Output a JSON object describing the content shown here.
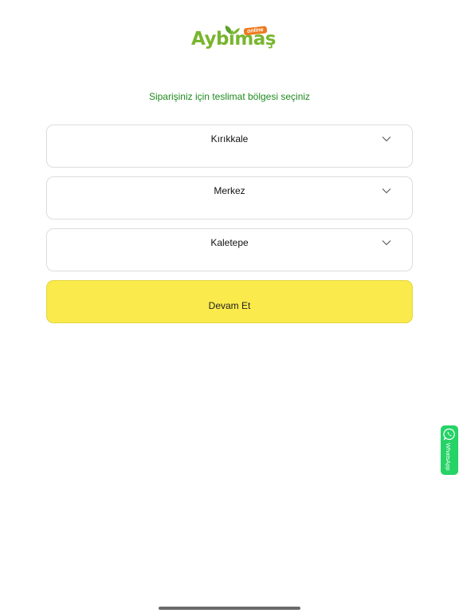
{
  "brand": {
    "name": "Aybimaş",
    "badge": "online",
    "color": "#79b52f",
    "badge_color": "#ec7a20",
    "leaf_color": "#5aa32a"
  },
  "prompt": {
    "text": "Siparişiniz için teslimat bölgesi seçiniz",
    "color": "#1e8a1e"
  },
  "selects": {
    "city": {
      "value": "Kırıkkale",
      "icon": "chevron-down-icon"
    },
    "district": {
      "value": "Merkez",
      "icon": "chevron-down-icon"
    },
    "neighborhood": {
      "value": "Kaletepe",
      "icon": "chevron-down-icon"
    }
  },
  "continue_button": {
    "label": "Devam Et",
    "color": "#faea4b"
  },
  "whatsapp": {
    "label": "WhatsApp",
    "icon": "whatsapp-icon",
    "color": "#25d366"
  }
}
